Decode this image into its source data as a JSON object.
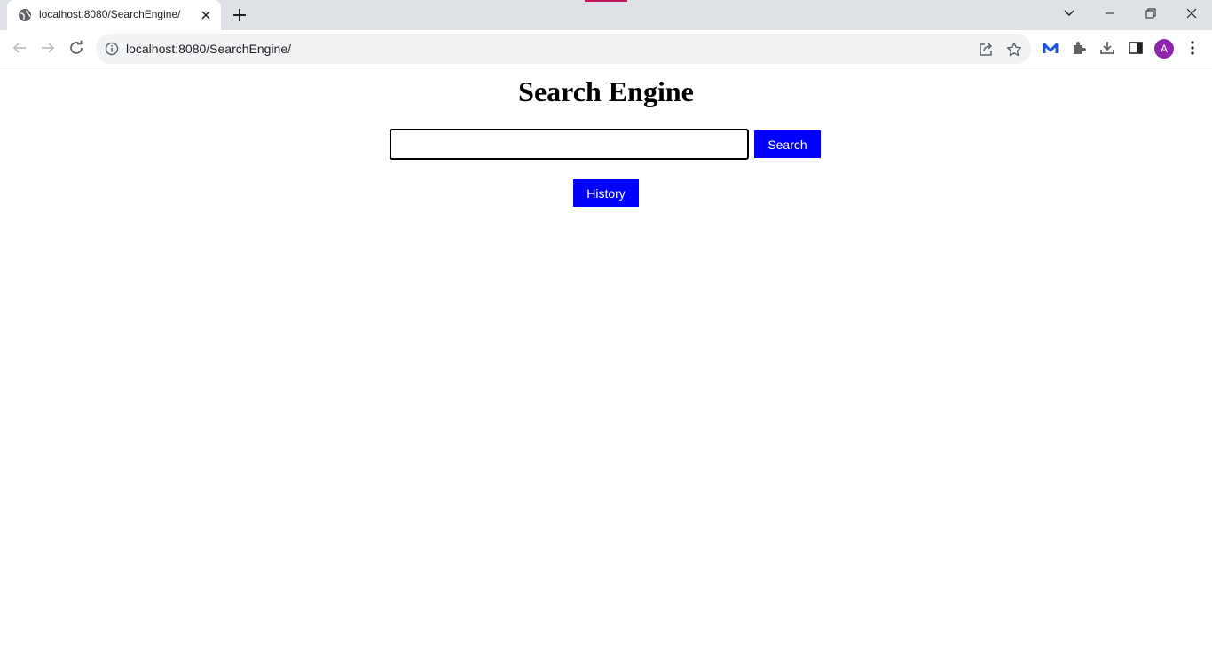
{
  "browser": {
    "tab": {
      "title": "localhost:8080/SearchEngine/"
    },
    "address_bar": {
      "url": "localhost:8080/SearchEngine/"
    },
    "profile_initial": "A",
    "colors": {
      "tab_strip": "#dee1e6",
      "avatar": "#8e24aa",
      "extension_icon": "#1a56db"
    }
  },
  "page": {
    "title": "Search Engine",
    "search": {
      "value": "",
      "placeholder": "",
      "button_label": "Search"
    },
    "history_button_label": "History",
    "colors": {
      "button_bg": "#0000ff",
      "button_text": "#ffffff"
    }
  }
}
